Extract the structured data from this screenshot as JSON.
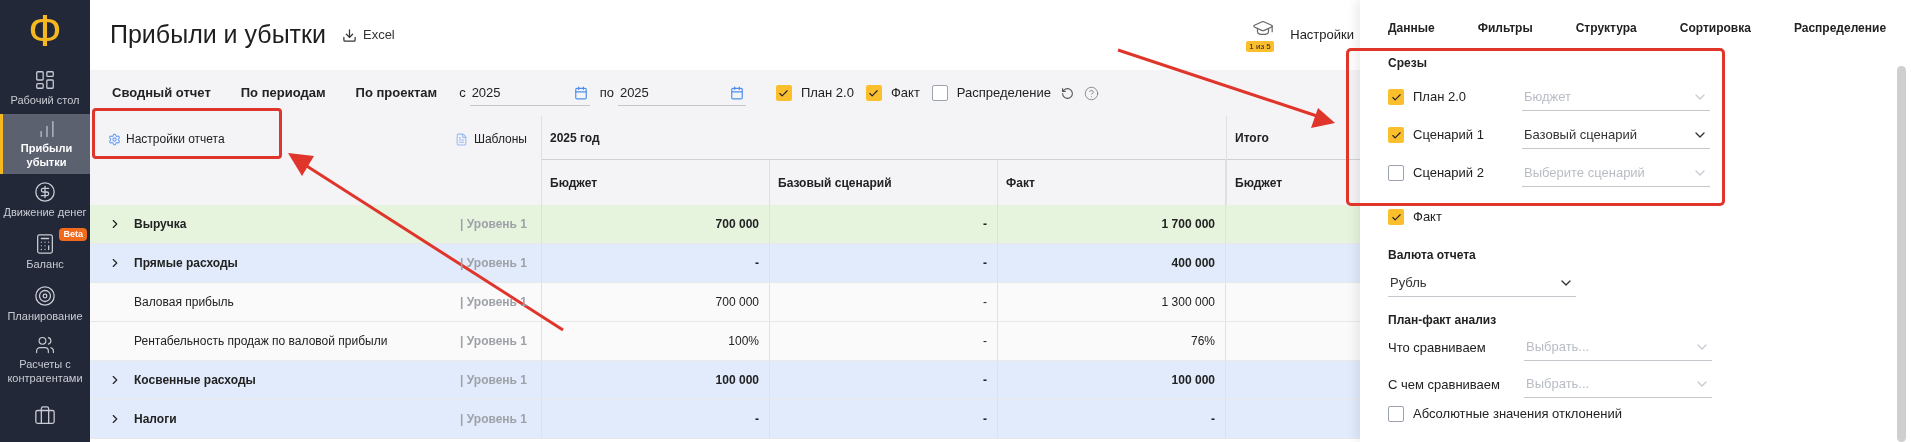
{
  "sidebar": {
    "logo": "Ф",
    "items": [
      {
        "label": "Рабочий стол",
        "selected": false
      },
      {
        "label": "Прибыли убытки",
        "selected": true
      },
      {
        "label": "Движение денег",
        "selected": false
      },
      {
        "label": "Баланс",
        "badge": "Beta",
        "selected": false
      },
      {
        "label": "Планирование",
        "selected": false
      },
      {
        "label": "Расчеты с контрагентами",
        "selected": false
      },
      {
        "selected": false
      }
    ]
  },
  "header": {
    "title": "Прибыли и убытки",
    "export": "Excel",
    "settings": {
      "label": "Настройки",
      "badge": "1 из 5"
    }
  },
  "toolbar": {
    "tabs": [
      "Сводный отчет",
      "По периодам",
      "По проектам"
    ],
    "date_from": {
      "label": "с",
      "value": "2025"
    },
    "date_to": {
      "label": "по",
      "value": "2025"
    },
    "checkboxes": [
      {
        "label": "План 2.0",
        "checked": true
      },
      {
        "label": "Факт",
        "checked": true
      },
      {
        "label": "Распределение",
        "checked": false
      }
    ]
  },
  "table": {
    "settings_button": "Настройки отчета",
    "templates_button": "Шаблоны",
    "groups": [
      {
        "label": "2025 год",
        "columns": [
          "Бюджет",
          "Базовый сценарий",
          "Факт"
        ]
      },
      {
        "label": "Итого",
        "columns": [
          "Бюджет"
        ]
      }
    ],
    "rows": [
      {
        "name": "Выручка",
        "level": "| Уровень 1",
        "expandable": true,
        "bold": true,
        "color": "#e6f4de",
        "values": [
          "700 000",
          "-",
          "1 700 000"
        ]
      },
      {
        "name": "Прямые расходы",
        "level": "| Уровень 1",
        "expandable": true,
        "bold": true,
        "color": "#e1ebfb",
        "values": [
          "-",
          "-",
          "400 000"
        ]
      },
      {
        "name": "Валовая прибыль",
        "level": "| Уровень 1",
        "expandable": false,
        "bold": false,
        "values": [
          "700 000",
          "-",
          "1 300 000"
        ]
      },
      {
        "name": "Рентабельность продаж по валовой прибыли",
        "level": "| Уровень 1",
        "expandable": false,
        "bold": false,
        "values": [
          "100%",
          "-",
          "76%"
        ]
      },
      {
        "name": "Косвенные расходы",
        "level": "| Уровень 1",
        "expandable": true,
        "bold": true,
        "color": "#e1ebfb",
        "values": [
          "100 000",
          "-",
          "100 000"
        ]
      },
      {
        "name": "Налоги",
        "level": "| Уровень 1",
        "expandable": true,
        "bold": true,
        "color": "#e1ebfb",
        "values": [
          "-",
          "-",
          "-"
        ]
      }
    ]
  },
  "panel": {
    "tabs": [
      "Данные",
      "Фильтры",
      "Структура",
      "Сортировка",
      "Распределение"
    ],
    "slices": {
      "title": "Срезы",
      "rows": [
        {
          "label": "План 2.0",
          "checked": true,
          "value": "Бюджет",
          "disabled": true
        },
        {
          "label": "Сценарий 1",
          "checked": true,
          "value": "Базовый сценарий",
          "disabled": false
        },
        {
          "label": "Сценарий 2",
          "checked": false,
          "placeholder": "Выберите сценарий",
          "disabled": true
        },
        {
          "label": "Факт",
          "checked": true
        }
      ]
    },
    "currency": {
      "title": "Валюта отчета",
      "value": "Рубль"
    },
    "analysis": {
      "title": "План-факт анализ",
      "fields": [
        {
          "label": "Что сравниваем",
          "placeholder": "Выбрать..."
        },
        {
          "label": "С чем сравниваем",
          "placeholder": "Выбрать..."
        }
      ],
      "checkbox": {
        "label": "Абсолютные значения отклонений",
        "checked": false
      }
    }
  }
}
